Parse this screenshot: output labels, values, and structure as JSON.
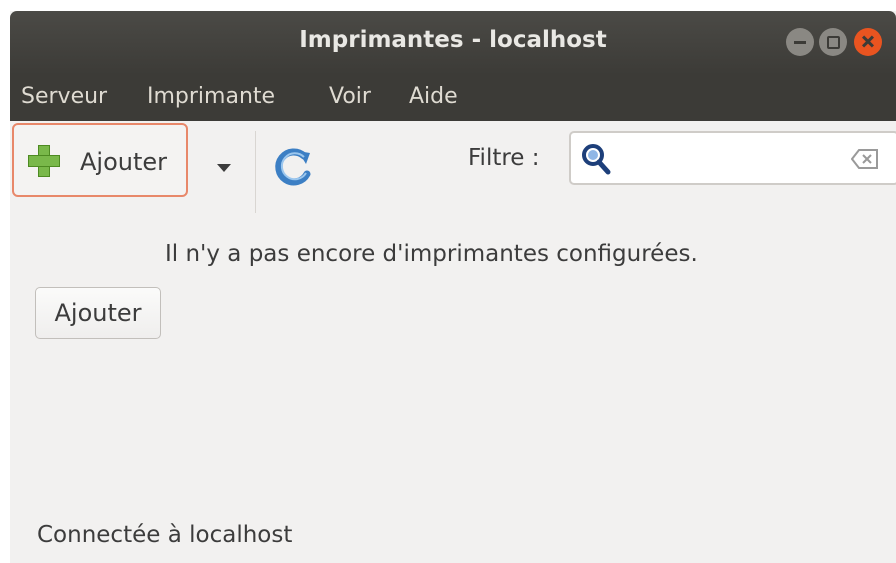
{
  "window": {
    "title": "Imprimantes - localhost"
  },
  "menu": {
    "items": [
      "Serveur",
      "Imprimante",
      "Voir",
      "Aide"
    ]
  },
  "toolbar": {
    "add_label": "Ajouter",
    "filter_label": "Filtre :",
    "filter_value": ""
  },
  "main": {
    "empty_message": "Il n'y a pas encore d'imprimantes configurées.",
    "add_button_label": "Ajouter"
  },
  "status": {
    "text": "Connectée à localhost"
  },
  "icons": {
    "add": "plus-icon",
    "dropdown": "chevron-down-icon",
    "refresh": "refresh-icon",
    "search": "search-icon",
    "clear": "clear-icon",
    "minimize": "minimize-icon",
    "maximize": "maximize-icon",
    "close": "close-icon"
  },
  "colors": {
    "titlebar": "#3c3b37",
    "accent_close": "#e95420",
    "focus_border": "#e8886a",
    "background": "#f2f1f0"
  }
}
